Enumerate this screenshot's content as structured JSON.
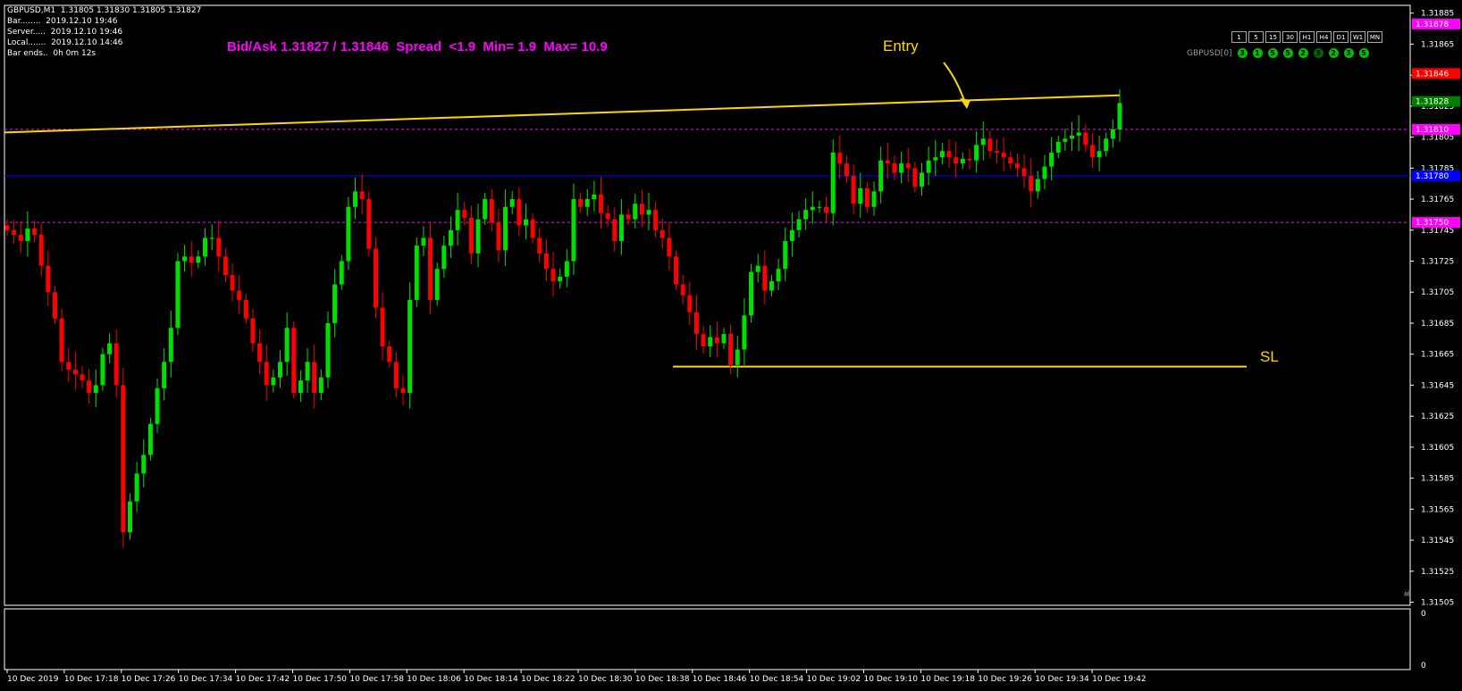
{
  "header": {
    "symbol_line": "GBPUSD,M1  1.31805 1.31830 1.31805 1.31827",
    "bar": "Bar........  2019.12.10 19:46",
    "server": "Server.....  2019.12.10 19:46",
    "local": "Local.......  2019.12.10 14:46",
    "bar_ends": "Bar ends..  0h 0m 12s"
  },
  "bidask_text": "Bid/Ask 1.31827 / 1.31846  Spread  <1.9  Min= 1.9  Max= 10.9",
  "entry_label": "Entry",
  "sl_label": "SL",
  "timeframes": [
    "1",
    "5",
    "15",
    "30",
    "H1",
    "H4",
    "D1",
    "W1",
    "MN"
  ],
  "strength": {
    "label": "GBPUSD[0]",
    "values": [
      "3",
      "1",
      "5",
      "5",
      "2",
      "3",
      "2",
      "3",
      "5"
    ]
  },
  "colors": {
    "bull": "#00e000",
    "bear": "#ff0000",
    "bid_line": "#0000ff",
    "grid_dash": "#ff00ff",
    "trend": "#ffd700",
    "axis_text": "#ffffff"
  },
  "chart_data": {
    "type": "candlestick",
    "title": "GBPUSD,M1",
    "price_ticks": [
      "1.31885",
      "1.31865",
      "1.31845",
      "1.31825",
      "1.31805",
      "1.31785",
      "1.31765",
      "1.31745",
      "1.31725",
      "1.31705",
      "1.31685",
      "1.31665",
      "1.31645",
      "1.31625",
      "1.31605",
      "1.31585",
      "1.31565",
      "1.31545",
      "1.31525",
      "1.31505"
    ],
    "ylim": [
      1.31503,
      1.3189
    ],
    "price_labels": [
      {
        "text": "1.31878",
        "price": 1.31878,
        "bg": "#ff00ff"
      },
      {
        "text": "1.31846",
        "price": 1.31846,
        "bg": "#ff0000"
      },
      {
        "text": "1.31828",
        "price": 1.31828,
        "bg": "#008000"
      },
      {
        "text": "1.31810",
        "price": 1.3181,
        "bg": "#ff00ff"
      },
      {
        "text": "1.31780",
        "price": 1.3178,
        "bg": "#0000ff"
      },
      {
        "text": "1.31750",
        "price": 1.3175,
        "bg": "#ff00ff"
      }
    ],
    "hlines": [
      {
        "price": 1.3181,
        "style": "dash",
        "color": "#ff00ff"
      },
      {
        "price": 1.3178,
        "style": "solid",
        "color": "#0000ff"
      },
      {
        "price": 1.3175,
        "style": "dash",
        "color": "#ff00ff"
      }
    ],
    "time_labels": [
      "10 Dec 2019",
      "10 Dec 17:18",
      "10 Dec 17:26",
      "10 Dec 17:34",
      "10 Dec 17:42",
      "10 Dec 17:50",
      "10 Dec 17:58",
      "10 Dec 18:06",
      "10 Dec 18:14",
      "10 Dec 18:22",
      "10 Dec 18:30",
      "10 Dec 18:38",
      "10 Dec 18:46",
      "10 Dec 18:54",
      "10 Dec 19:02",
      "10 Dec 19:10",
      "10 Dec 19:18",
      "10 Dec 19:26",
      "10 Dec 19:34",
      "10 Dec 19:42"
    ],
    "indicator_axis": [
      "0",
      "0"
    ],
    "closes": [
      1.31745,
      1.31742,
      1.31738,
      1.31746,
      1.31742,
      1.31722,
      1.31705,
      1.31688,
      1.3166,
      1.31655,
      1.31652,
      1.31648,
      1.3164,
      1.31645,
      1.31665,
      1.31672,
      1.31645,
      1.3155,
      1.3157,
      1.31588,
      1.316,
      1.3162,
      1.31643,
      1.3166,
      1.31682,
      1.31725,
      1.31728,
      1.31724,
      1.31728,
      1.3174,
      1.3174,
      1.31728,
      1.31716,
      1.31706,
      1.317,
      1.31688,
      1.31672,
      1.3166,
      1.31645,
      1.3165,
      1.3166,
      1.31682,
      1.3164,
      1.31648,
      1.3166,
      1.3164,
      1.3165,
      1.31685,
      1.3171,
      1.31725,
      1.3176,
      1.3177,
      1.31765,
      1.31733,
      1.31695,
      1.3167,
      1.3166,
      1.31643,
      1.3164,
      1.317,
      1.31735,
      1.3174,
      1.317,
      1.3172,
      1.31735,
      1.31745,
      1.31758,
      1.31753,
      1.3173,
      1.31752,
      1.31765,
      1.3175,
      1.31732,
      1.3176,
      1.31765,
      1.31748,
      1.31752,
      1.3174,
      1.3173,
      1.3172,
      1.31712,
      1.31715,
      1.31725,
      1.31765,
      1.3176,
      1.31765,
      1.31768,
      1.31756,
      1.31752,
      1.31738,
      1.31755,
      1.31752,
      1.31762,
      1.31755,
      1.31758,
      1.31745,
      1.3174,
      1.31728,
      1.3171,
      1.31703,
      1.31692,
      1.31678,
      1.3167,
      1.31676,
      1.31672,
      1.31678,
      1.31658,
      1.31668,
      1.3169,
      1.31718,
      1.31722,
      1.31706,
      1.31712,
      1.3172,
      1.31738,
      1.31745,
      1.31752,
      1.31758,
      1.3176,
      1.3176,
      1.31756,
      1.31795,
      1.31788,
      1.3178,
      1.31762,
      1.31772,
      1.3176,
      1.3177,
      1.3179,
      1.31788,
      1.31782,
      1.31788,
      1.31785,
      1.31773,
      1.31782,
      1.3179,
      1.31792,
      1.31796,
      1.31792,
      1.31788,
      1.31791,
      1.3179,
      1.318,
      1.31804,
      1.31796,
      1.31795,
      1.31792,
      1.31788,
      1.31785,
      1.3178,
      1.3177,
      1.31778,
      1.31786,
      1.31795,
      1.31802,
      1.31804,
      1.31806,
      1.31808,
      1.318,
      1.31792,
      1.31796,
      1.31804,
      1.3181,
      1.31827
    ]
  }
}
